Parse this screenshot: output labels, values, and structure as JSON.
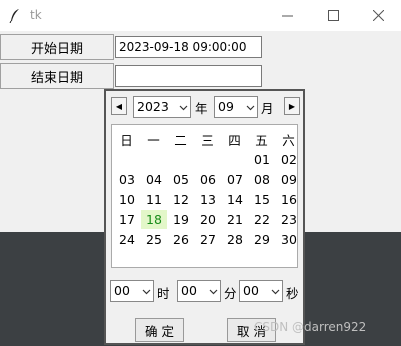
{
  "window": {
    "title": "tk"
  },
  "form": {
    "start_label": "开始日期",
    "start_value": "2023-09-18 09:00:00",
    "end_label": "结束日期",
    "end_value": ""
  },
  "picker": {
    "year": "2023",
    "year_unit": "年",
    "month": "09",
    "month_unit": "月",
    "weekdays": [
      "日",
      "一",
      "二",
      "三",
      "四",
      "五",
      "六"
    ],
    "weeks": [
      [
        "",
        "",
        "",
        "",
        "",
        "01",
        "02"
      ],
      [
        "03",
        "04",
        "05",
        "06",
        "07",
        "08",
        "09"
      ],
      [
        "10",
        "11",
        "12",
        "13",
        "14",
        "15",
        "16"
      ],
      [
        "17",
        "18",
        "19",
        "20",
        "21",
        "22",
        "23"
      ],
      [
        "24",
        "25",
        "26",
        "27",
        "28",
        "29",
        "30"
      ]
    ],
    "today": "18",
    "hour": "00",
    "hour_unit": "时",
    "minute": "00",
    "minute_unit": "分",
    "second": "00",
    "second_unit": "秒",
    "ok_label": "确 定",
    "cancel_label": "取 消"
  },
  "watermark": "CSDN @darren922"
}
